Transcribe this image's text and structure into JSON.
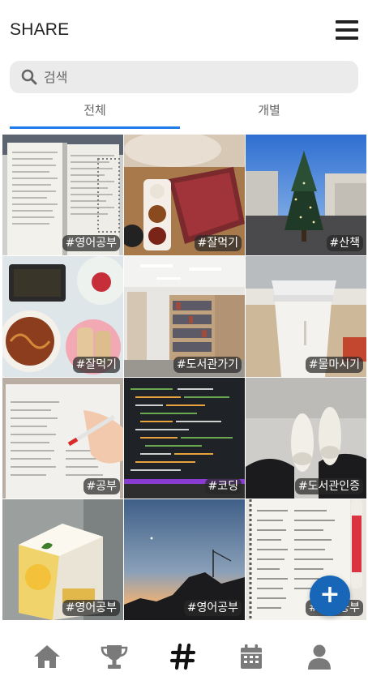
{
  "header": {
    "title": "SHARE",
    "menu_icon": "hamburger-menu-icon"
  },
  "search": {
    "placeholder": "검색",
    "value": "",
    "icon": "search-icon"
  },
  "tabs": [
    {
      "label": "전체",
      "active": true
    },
    {
      "label": "개별",
      "active": false
    }
  ],
  "colors": {
    "accent": "#1e7be8",
    "fab": "#1766b8",
    "nav_icon": "#7a7a7a",
    "nav_active": "#111111"
  },
  "posts": [
    {
      "tag": "#영어공부",
      "subject": "open English workbook"
    },
    {
      "tag": "#잘먹기",
      "subject": "raw meat and dipping sauces"
    },
    {
      "tag": "#산책",
      "subject": "christmas tree on street"
    },
    {
      "tag": "#잘먹기",
      "subject": "pasta, bread and salad"
    },
    {
      "tag": "#도서관가기",
      "subject": "library bookshelves"
    },
    {
      "tag": "#물마시기",
      "subject": "white tumbler cup"
    },
    {
      "tag": "#공부",
      "subject": "writing in a textbook"
    },
    {
      "tag": "#코딩",
      "subject": "code on a monitor"
    },
    {
      "tag": "#도서관인증",
      "subject": "white sneakers"
    },
    {
      "tag": "#영어공부",
      "subject": "juice carton"
    },
    {
      "tag": "#영어공부",
      "subject": "sunset skyline"
    },
    {
      "tag": "#영어공부",
      "subject": "handwritten vocabulary notebook"
    }
  ],
  "fab": {
    "label": "+"
  },
  "bottom_nav": [
    {
      "icon": "home-icon",
      "active": false
    },
    {
      "icon": "trophy-icon",
      "active": false
    },
    {
      "icon": "hashtag-icon",
      "active": true
    },
    {
      "icon": "calendar-icon",
      "active": false
    },
    {
      "icon": "profile-icon",
      "active": false
    }
  ]
}
